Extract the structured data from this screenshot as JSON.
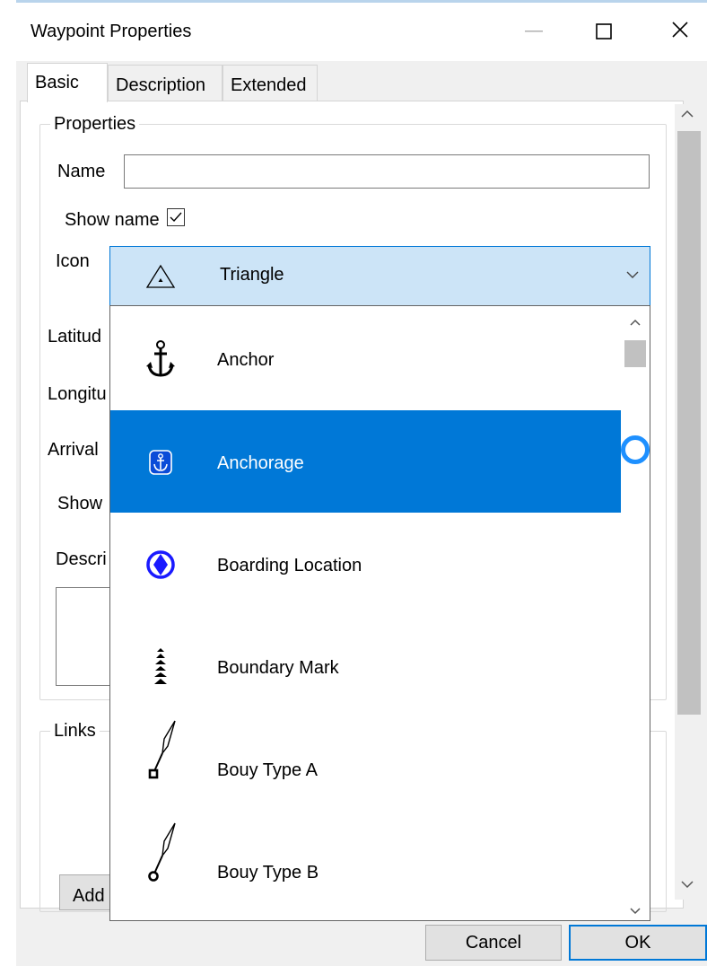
{
  "window": {
    "title": "Waypoint Properties",
    "controls": {
      "minimize": "—",
      "maximize": "☐",
      "close": "✕"
    }
  },
  "tabs": [
    {
      "label": "Basic",
      "active": true
    },
    {
      "label": "Description",
      "active": false
    },
    {
      "label": "Extended",
      "active": false
    }
  ],
  "properties": {
    "legend": "Properties",
    "name_label": "Name",
    "name_value": "",
    "show_name_label": "Show name",
    "show_name_checked": true,
    "icon_label": "Icon",
    "icon_selected": {
      "label": "Triangle",
      "icon": "triangle-icon"
    },
    "latitude_label": "Latitud",
    "longitude_label": "Longitu",
    "arrival_label": "Arrival",
    "show_label": "Show",
    "description_label": "Descri"
  },
  "links": {
    "legend": "Links",
    "add_button": "Add"
  },
  "icon_dropdown": {
    "items": [
      {
        "label": "Anchor",
        "icon": "anchor-icon",
        "selected": false
      },
      {
        "label": "Anchorage",
        "icon": "anchorage-icon",
        "selected": true
      },
      {
        "label": "Boarding Location",
        "icon": "boarding-location-icon",
        "selected": false
      },
      {
        "label": "Boundary Mark",
        "icon": "boundary-mark-icon",
        "selected": false
      },
      {
        "label": "Bouy Type A",
        "icon": "buoy-type-a-icon",
        "selected": false
      },
      {
        "label": "Bouy Type B",
        "icon": "buoy-type-b-icon",
        "selected": false
      }
    ]
  },
  "buttons": {
    "cancel": "Cancel",
    "ok": "OK"
  },
  "colors": {
    "accent": "#0078d7",
    "combo_bg": "#cce4f7",
    "boarding_icon": "#1a1aff"
  }
}
